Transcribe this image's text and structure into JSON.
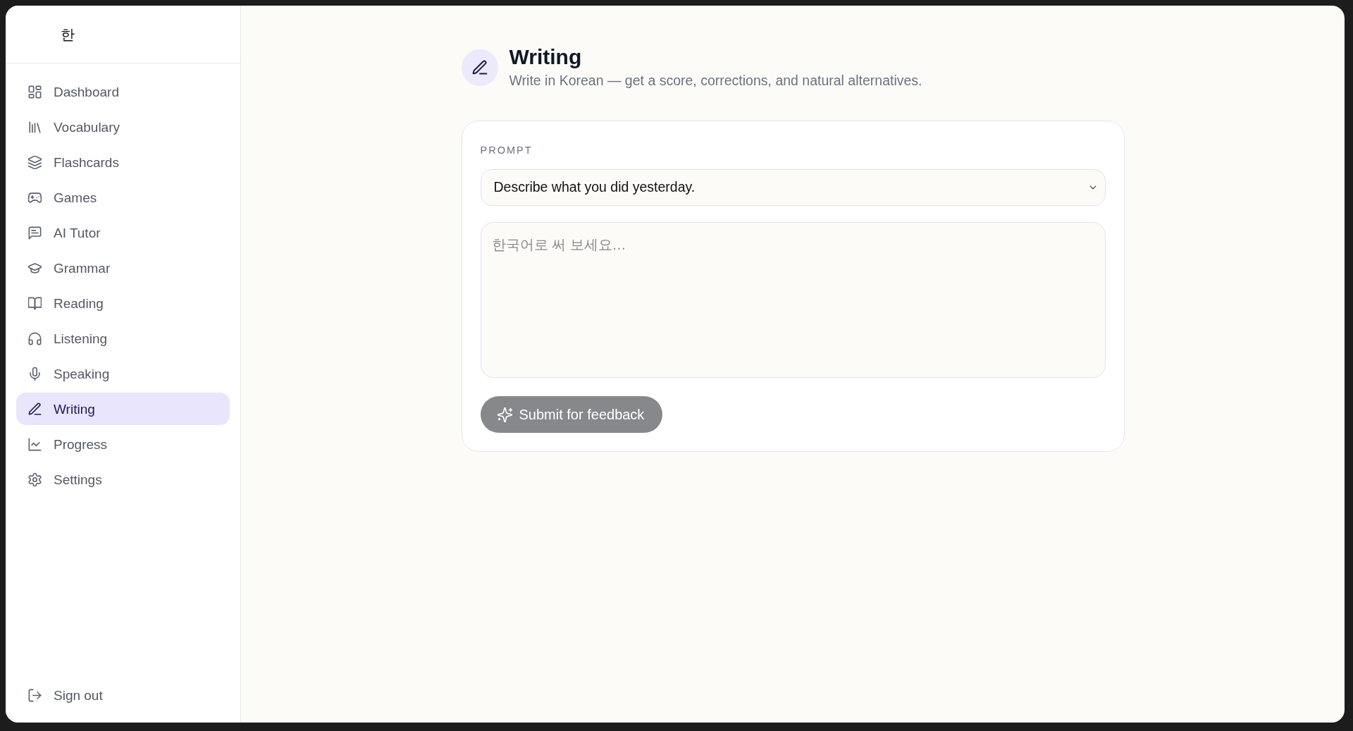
{
  "sidebar": {
    "logo": "한",
    "items": [
      {
        "label": "Dashboard",
        "selected": false
      },
      {
        "label": "Vocabulary",
        "selected": false
      },
      {
        "label": "Flashcards",
        "selected": false
      },
      {
        "label": "Games",
        "selected": false
      },
      {
        "label": "AI Tutor",
        "selected": false
      },
      {
        "label": "Grammar",
        "selected": false
      },
      {
        "label": "Reading",
        "selected": false
      },
      {
        "label": "Listening",
        "selected": false
      },
      {
        "label": "Speaking",
        "selected": false
      },
      {
        "label": "Writing",
        "selected": true
      },
      {
        "label": "Progress",
        "selected": false
      },
      {
        "label": "Settings",
        "selected": false
      }
    ],
    "sign_out": {
      "label": "Sign out"
    }
  },
  "header": {
    "title": "Writing",
    "subtitle": "Write in Korean — get a score, corrections, and natural alternatives."
  },
  "card": {
    "prompt_label": "PROMPT",
    "prompt_select": {
      "value": "Describe what you did yesterday."
    },
    "answer_field": {
      "placeholder": "한국어로 써 보세요…"
    },
    "submit_button": {
      "label": "Submit for feedback",
      "disabled": true
    }
  }
}
